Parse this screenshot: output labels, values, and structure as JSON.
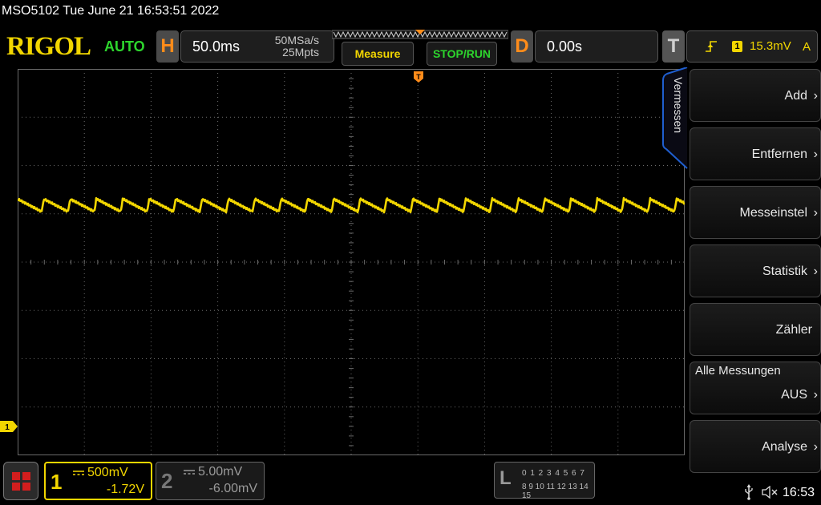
{
  "title_bar": {
    "text": "MSO5102  Tue June 21 16:53:51 2022"
  },
  "header": {
    "logo": "RIGOL",
    "run_status": "AUTO",
    "horizontal": {
      "letter": "H",
      "timebase": "50.0ms",
      "sample_rate": "50MSa/s",
      "memory_depth": "25Mpts"
    },
    "measure_label": "Measure",
    "stoprun_label": "STOP/RUN",
    "delay": {
      "letter": "D",
      "value": "0.00s"
    },
    "trigger": {
      "letter": "T",
      "source": "1",
      "level": "15.3mV",
      "mode": "A"
    }
  },
  "side_menu": {
    "tab_label": "Vermessen",
    "items": [
      {
        "label": "Add"
      },
      {
        "label": "Entfernen"
      },
      {
        "label": "Messeinstel"
      },
      {
        "label": "Statistik"
      },
      {
        "label": "Zähler"
      },
      {
        "title": "Alle Messungen",
        "value": "AUS"
      },
      {
        "label": "Analyse"
      }
    ]
  },
  "waveform": {
    "channel": "1",
    "color": "#f2d600",
    "trigger_marker_label": "T"
  },
  "channels": [
    {
      "num": "1",
      "scale": "500mV",
      "offset": "-1.72V",
      "color": "#f2d600",
      "active": true
    },
    {
      "num": "2",
      "scale": "5.00mV",
      "offset": "-6.00mV",
      "color": "#8a8a8a",
      "active": false
    }
  ],
  "la": {
    "letter": "L",
    "row1": "0 1 2 3  4 5 6 7",
    "row2": "8 9 10 11 12 13 14 15"
  },
  "status": {
    "clock": "16:53"
  },
  "colors": {
    "accent_yellow": "#f2d600",
    "accent_orange": "#ff8c1a",
    "accent_green": "#2dd52d",
    "grid": "#6a6a6a",
    "menu_tab_border": "#1f5fd0"
  }
}
